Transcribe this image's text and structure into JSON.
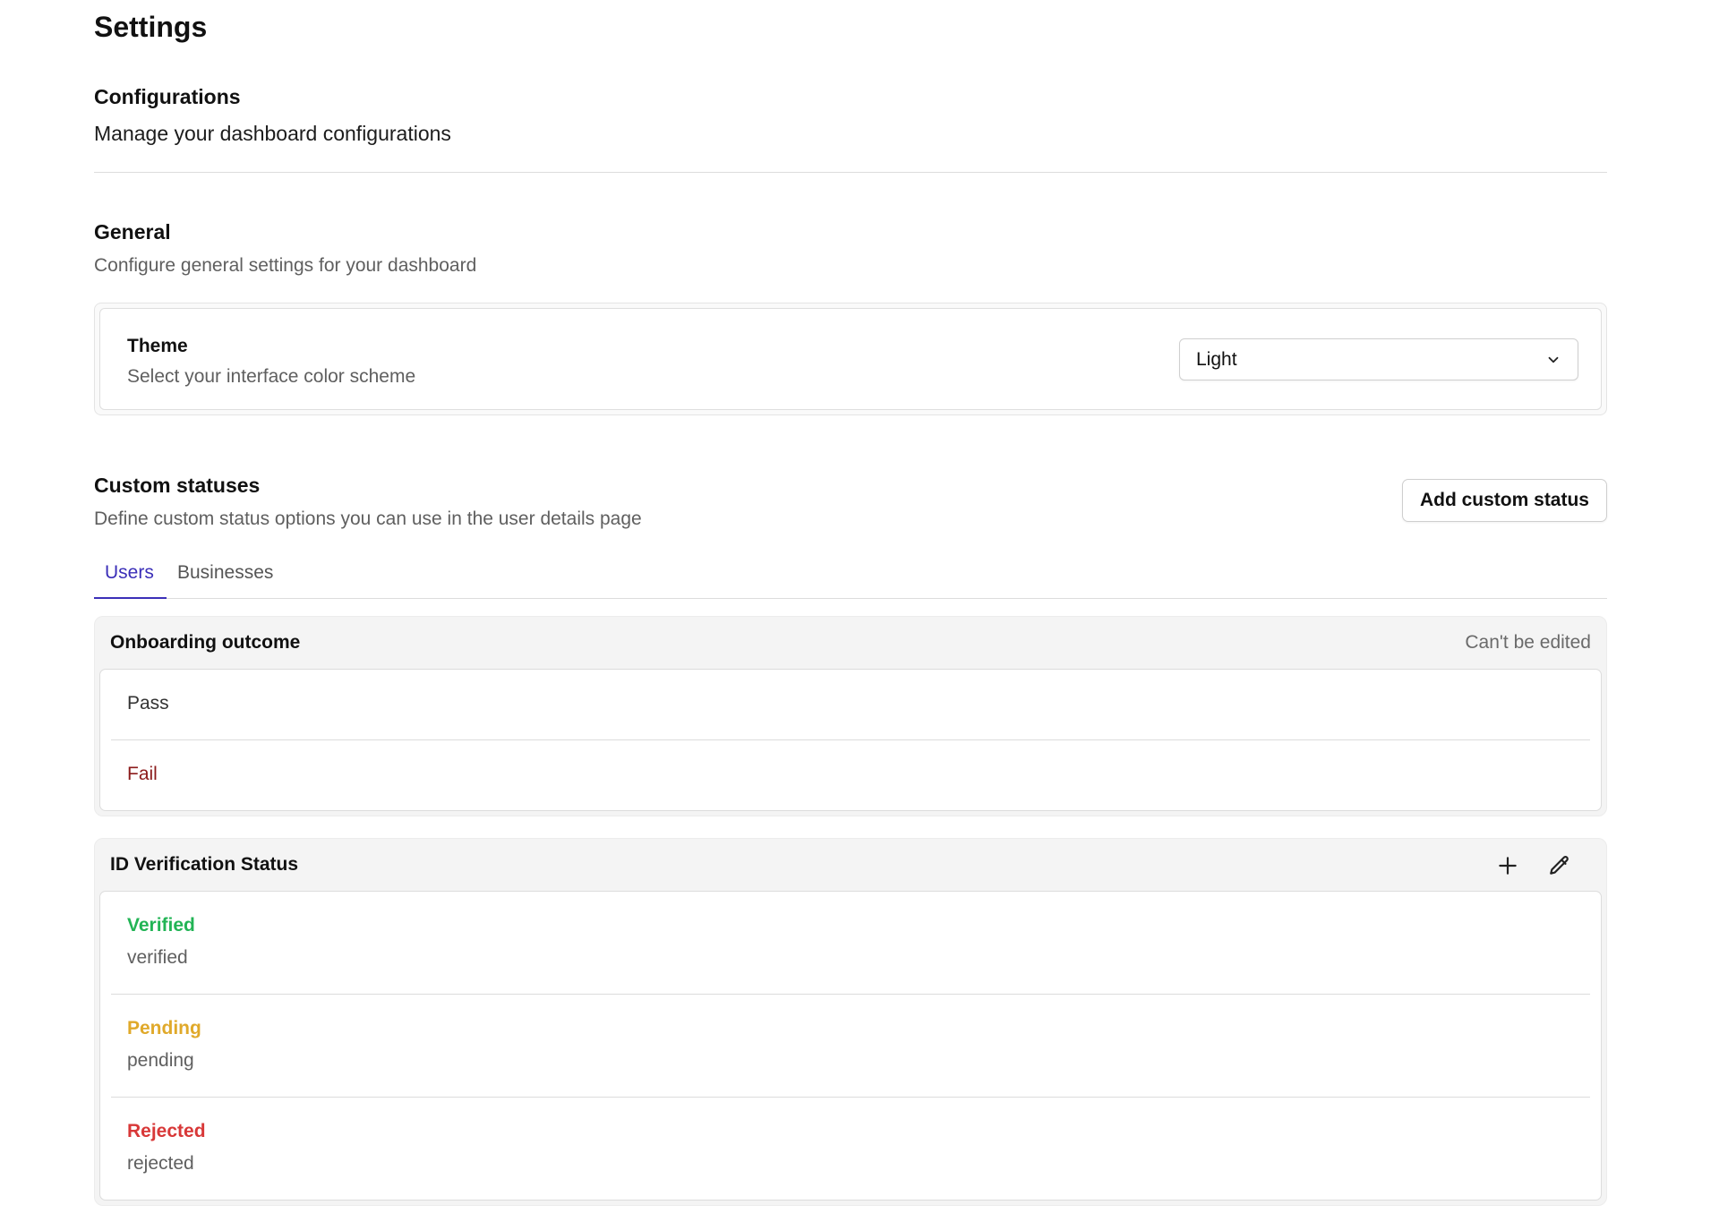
{
  "page": {
    "title": "Settings"
  },
  "configurations": {
    "title": "Configurations",
    "description": "Manage your dashboard configurations"
  },
  "general": {
    "title": "General",
    "description": "Configure general settings for your dashboard",
    "theme": {
      "label": "Theme",
      "description": "Select your interface color scheme",
      "selected": "Light"
    }
  },
  "custom_statuses": {
    "title": "Custom statuses",
    "description": "Define custom status options you can use in the user details page",
    "add_button": "Add custom status",
    "tabs": [
      {
        "label": "Users",
        "active": true
      },
      {
        "label": "Businesses",
        "active": false
      }
    ],
    "groups": [
      {
        "title": "Onboarding outcome",
        "note": "Can't be edited",
        "items": [
          {
            "label": "Pass",
            "color": "#333333"
          },
          {
            "label": "Fail",
            "color": "#8b1a1a"
          }
        ]
      },
      {
        "title": "ID Verification Status",
        "icons": [
          "plus-icon",
          "pencil-icon"
        ],
        "items": [
          {
            "label": "Verified",
            "value": "verified",
            "color": "#22b455"
          },
          {
            "label": "Pending",
            "value": "pending",
            "color": "#e0a92a"
          },
          {
            "label": "Rejected",
            "value": "rejected",
            "color": "#d83838"
          }
        ]
      }
    ]
  },
  "colors": {
    "accent": "#3b2fb8",
    "border": "#dcdcdc",
    "muted_text": "#5f5f5f",
    "group_bg": "#f4f4f4"
  }
}
